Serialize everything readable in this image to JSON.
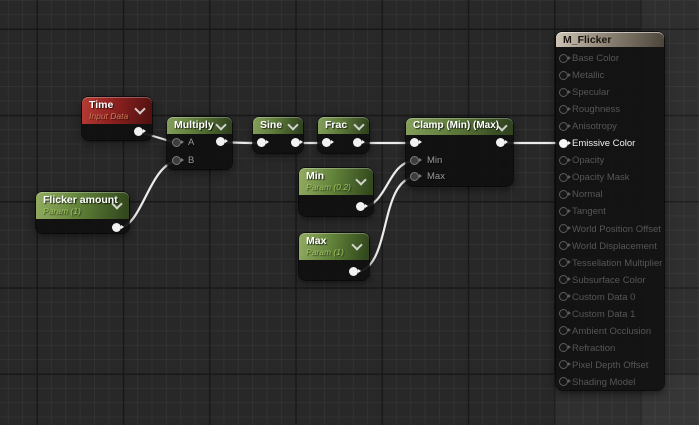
{
  "editor": "Unreal Engine Material Graph",
  "colors": {
    "canvas_bg": "#282828",
    "grid_minor": "#323232",
    "grid_major": "#181818",
    "wire": "#ececec",
    "input_node_header": "#8e2120",
    "math_node_header": "#5d7a3a",
    "param_node_header": "#62833a",
    "material_node_header": "#9a9183"
  },
  "graph": {
    "nodes": {
      "time": {
        "title": "Time",
        "subtitle": "Input Data"
      },
      "multiply": {
        "title": "Multiply",
        "pins": {
          "a": "A",
          "b": "B"
        }
      },
      "sine": {
        "title": "Sine"
      },
      "frac": {
        "title": "Frac"
      },
      "clamp": {
        "title": "Clamp (Min) (Max)",
        "pins": {
          "min": "Min",
          "max": "Max"
        }
      },
      "flicker_amount": {
        "title": "Flicker amount",
        "subtitle": "Param (1)"
      },
      "min_param": {
        "title": "Min",
        "subtitle": "Param (0.2)"
      },
      "max_param": {
        "title": "Max",
        "subtitle": "Param (1)"
      }
    },
    "material": {
      "title": "M_Flicker",
      "active_pin": "Emissive Color",
      "pins": [
        "Base Color",
        "Metallic",
        "Specular",
        "Roughness",
        "Anisotropy",
        "Emissive Color",
        "Opacity",
        "Opacity Mask",
        "Normal",
        "Tangent",
        "World Position Offset",
        "World Displacement",
        "Tessellation Multiplier",
        "Subsurface Color",
        "Custom Data 0",
        "Custom Data 1",
        "Ambient Occlusion",
        "Refraction",
        "Pixel Depth Offset",
        "Shading Model"
      ]
    },
    "connections": [
      {
        "from": "Time.Output",
        "to": "Multiply.A"
      },
      {
        "from": "Flicker amount.Output",
        "to": "Multiply.B"
      },
      {
        "from": "Multiply.Output",
        "to": "Sine.Input"
      },
      {
        "from": "Sine.Output",
        "to": "Frac.Input"
      },
      {
        "from": "Frac.Output",
        "to": "Clamp (Min) (Max).Input"
      },
      {
        "from": "Min.Output",
        "to": "Clamp (Min) (Max).Min"
      },
      {
        "from": "Max.Output",
        "to": "Clamp (Min) (Max).Max"
      },
      {
        "from": "Clamp (Min) (Max).Output",
        "to": "M_Flicker.Emissive Color"
      }
    ]
  }
}
